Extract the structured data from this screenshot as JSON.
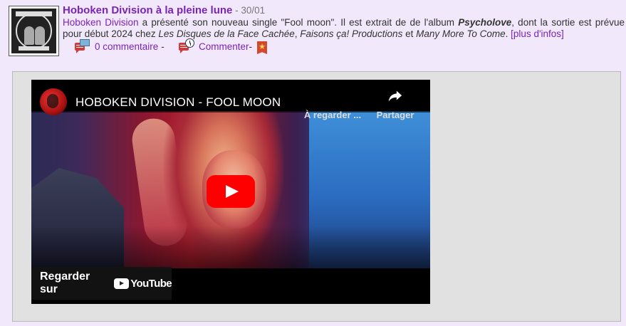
{
  "post": {
    "title": "Hoboken Division à la pleine lune",
    "date_sep": " - ",
    "date": "30/01",
    "thumbnail_alt": "Psycholove album cover"
  },
  "description": {
    "artist": "Hoboken Division",
    "text1": " a présenté son nouveau single \"Fool moon\". Il est extrait de de l'album ",
    "album": "Psycholove",
    "text2": ", dont la sortie est prévue pour début 2024 chez ",
    "label1": "Les Disques de la Face Cachée",
    "sep1": ", ",
    "label2": "Faisons ça! Productions",
    "sep2": " et ",
    "label3": "Many More To Come",
    "text3": ". ",
    "more": "[plus d'infos]"
  },
  "actions": {
    "comments_count": "0 commentaire",
    "dash1": " -",
    "comment": "Commenter",
    "dash2": " -"
  },
  "video": {
    "title": "HOBOKEN DIVISION - FOOL MOON",
    "watch_later": "À regarder ...",
    "share": "Partager",
    "watch_on": "Regarder sur",
    "youtube": "YouTube"
  }
}
